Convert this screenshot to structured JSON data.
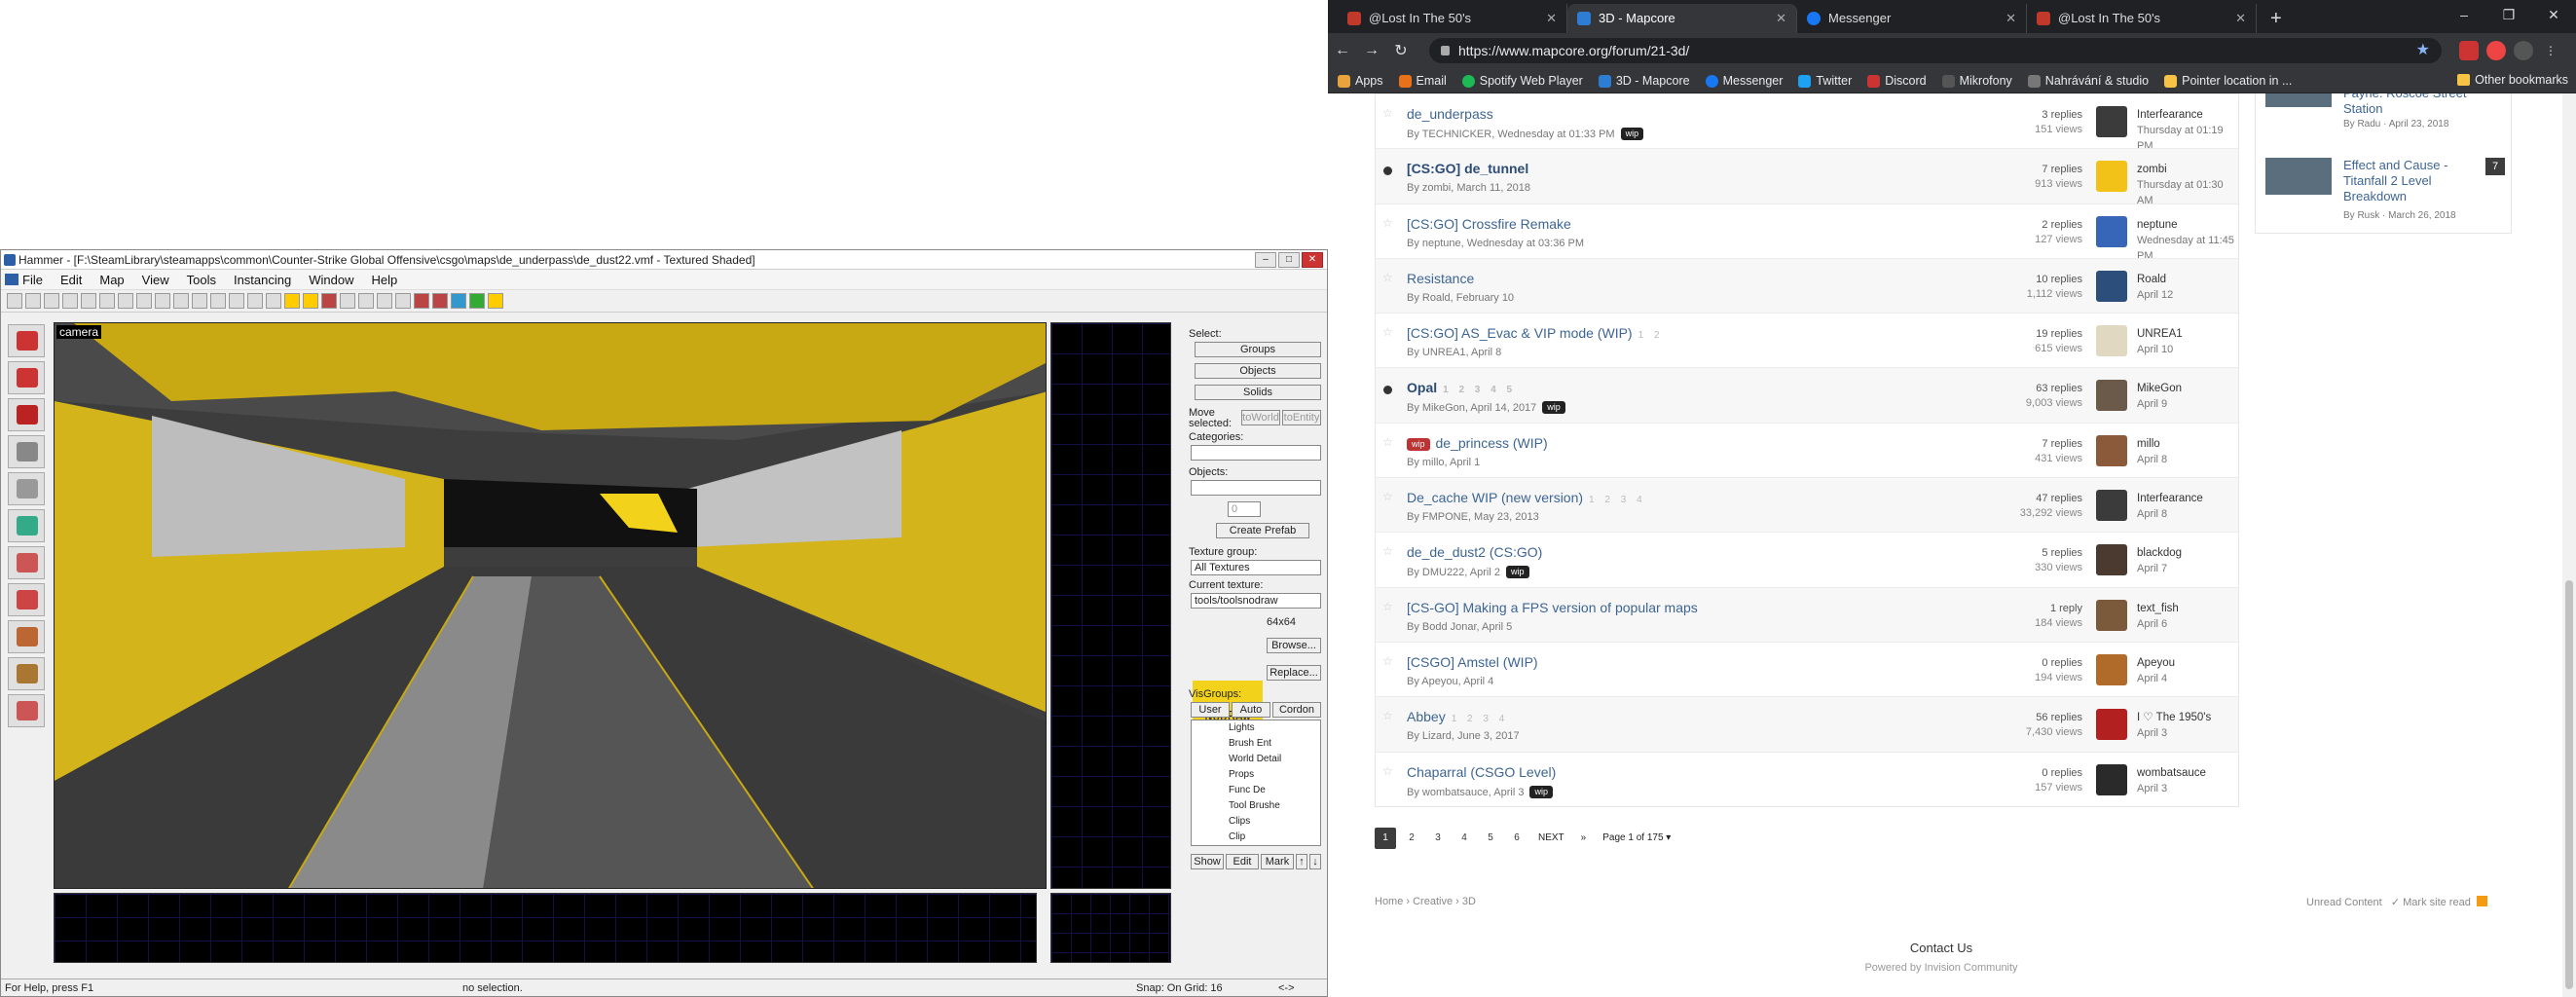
{
  "hammer": {
    "title": "Hammer - [F:\\SteamLibrary\\steamapps\\common\\Counter-Strike Global Offensive\\csgo\\maps\\de_underpass\\de_dust22.vmf - Textured Shaded]",
    "menu": [
      "File",
      "Edit",
      "Map",
      "View",
      "Tools",
      "Instancing",
      "Window",
      "Help"
    ],
    "camera_label": "camera",
    "panel": {
      "select_label": "Select:",
      "groups": "Groups",
      "objects": "Objects",
      "solids": "Solids",
      "move_selected": "Move selected:",
      "to_world": "toWorld",
      "to_entity": "toEntity",
      "categories": "Categories:",
      "objects_label": "Objects:",
      "count": "0",
      "create_prefab": "Create Prefab",
      "texture_group": "Texture group:",
      "texture_group_value": "All Textures",
      "current_texture": "Current texture:",
      "current_texture_value": "tools/toolsnodraw",
      "texture_size": "64x64",
      "texture_name": "NODRAW",
      "browse": "Browse...",
      "replace": "Replace...",
      "visgroups": "VisGroups:",
      "vis_tabs": [
        "User",
        "Auto",
        "Cordon"
      ],
      "vis_items": [
        "Lights",
        "Brush Ent",
        "World Detail",
        "Props",
        "Func De",
        "Tool Brushe",
        "Clips",
        "Clip"
      ],
      "show": "Show",
      "edit": "Edit",
      "mark": "Mark"
    },
    "status": {
      "help": "For Help, press F1",
      "selection": "no selection.",
      "snap": "Snap: On Grid: 16",
      "extra": "<->"
    }
  },
  "browser": {
    "tabs": [
      {
        "title": "@Lost In The 50's",
        "color": "#c0392b"
      },
      {
        "title": "3D - Mapcore",
        "color": "#2d7dd2"
      },
      {
        "title": "Messenger",
        "color": "#1877f2"
      },
      {
        "title": "@Lost In The 50's",
        "color": "#c0392b"
      }
    ],
    "url": "https://www.mapcore.org/forum/21-3d/",
    "bookmarks": [
      {
        "label": "Apps",
        "color": "#e8a33d"
      },
      {
        "label": "Email",
        "color": "#e8711a"
      },
      {
        "label": "Spotify Web Player",
        "color": "#1db954"
      },
      {
        "label": "3D - Mapcore",
        "color": "#2d7dd2"
      },
      {
        "label": "Messenger",
        "color": "#1877f2"
      },
      {
        "label": "Twitter",
        "color": "#1da1f2"
      },
      {
        "label": "Discord",
        "color": "#c33"
      },
      {
        "label": "Mikrofony",
        "color": "#555"
      },
      {
        "label": "Nahrávání & studio",
        "color": "#777"
      },
      {
        "label": "Pointer location in ...",
        "color": "#f6c344"
      }
    ],
    "other_bookmarks": "Other bookmarks"
  },
  "topics": [
    {
      "title": "de_underpass",
      "meta": "By TECHNICKER, Wednesday at 01:33 PM",
      "badge": "wip",
      "replies": "3 replies",
      "views": "151 views",
      "last_user": "Interfearance",
      "last_date": "Thursday at 01:19 PM",
      "unread": false,
      "bold": false,
      "pages": "",
      "av": "#3b3b3b"
    },
    {
      "title": "[CS:GO] de_tunnel",
      "meta": "By zombi, March 11, 2018",
      "badge": "",
      "replies": "7 replies",
      "views": "913 views",
      "last_user": "zombi",
      "last_date": "Thursday at 01:30 AM",
      "unread": true,
      "bold": true,
      "pages": "",
      "av": "#f2c218"
    },
    {
      "title": "[CS:GO] Crossfire Remake",
      "meta": "By neptune, Wednesday at 03:36 PM",
      "badge": "",
      "replies": "2 replies",
      "views": "127 views",
      "last_user": "neptune",
      "last_date": "Wednesday at 11:45 PM",
      "unread": false,
      "bold": false,
      "pages": "",
      "av": "#3766b8"
    },
    {
      "title": "Resistance",
      "meta": "By Roald, February 10",
      "badge": "",
      "replies": "10 replies",
      "views": "1,112 views",
      "last_user": "Roald",
      "last_date": "April 12",
      "unread": false,
      "bold": false,
      "pages": "",
      "av": "#2b4f7a"
    },
    {
      "title": "[CS:GO] AS_Evac & VIP mode (WIP)",
      "meta": "By UNREA1, April 8",
      "badge": "",
      "replies": "19 replies",
      "views": "615 views",
      "last_user": "UNREA1",
      "last_date": "April 10",
      "unread": false,
      "bold": false,
      "pages": "1 2",
      "av": "#e0d8c0"
    },
    {
      "title": "Opal",
      "meta": "By MikeGon, April 14, 2017",
      "badge": "wip",
      "replies": "63 replies",
      "views": "9,003 views",
      "last_user": "MikeGon",
      "last_date": "April 9",
      "unread": true,
      "bold": true,
      "pages": "1 2 3 4 5",
      "av": "#6b5a4a"
    },
    {
      "title": "de_princess (WIP)",
      "meta": "By millo, April 1",
      "badge": "",
      "pre_badge": "wip",
      "replies": "7 replies",
      "views": "431 views",
      "last_user": "millo",
      "last_date": "April 8",
      "unread": false,
      "bold": false,
      "pages": "",
      "av": "#8a5a3a"
    },
    {
      "title": "De_cache WIP (new version)",
      "meta": "By FMPONE, May 23, 2013",
      "badge": "",
      "replies": "47 replies",
      "views": "33,292 views",
      "last_user": "Interfearance",
      "last_date": "April 8",
      "unread": false,
      "bold": false,
      "pages": "1 2 3 4",
      "av": "#3b3b3b"
    },
    {
      "title": "de_de_dust2 (CS:GO)",
      "meta": "By DMU222, April 2",
      "badge": "wip",
      "replies": "5 replies",
      "views": "330 views",
      "last_user": "blackdog",
      "last_date": "April 7",
      "unread": false,
      "bold": false,
      "pages": "",
      "av": "#4a3a30"
    },
    {
      "title": "[CS-GO] Making a FPS version of popular maps",
      "meta": "By Bodd Jonar, April 5",
      "badge": "",
      "replies": "1 reply",
      "views": "184 views",
      "last_user": "text_fish",
      "last_date": "April 6",
      "unread": false,
      "bold": false,
      "pages": "",
      "av": "#7a5a3a"
    },
    {
      "title": "[CSGO] Amstel (WIP)",
      "meta": "By Apeyou, April 4",
      "badge": "",
      "replies": "0 replies",
      "views": "194 views",
      "last_user": "Apeyou",
      "last_date": "April 4",
      "unread": false,
      "bold": false,
      "pages": "",
      "av": "#b06a2a"
    },
    {
      "title": "Abbey",
      "meta": "By Lizard, June 3, 2017",
      "badge": "",
      "replies": "56 replies",
      "views": "7,430 views",
      "last_user": "I ♡ The 1950's",
      "last_date": "April 3",
      "unread": false,
      "bold": false,
      "pages": "1 2 3 4",
      "av": "#b32020"
    },
    {
      "title": "Chaparral (CSGO Level)",
      "meta": "By wombatsauce, April 3",
      "badge": "wip",
      "replies": "0 replies",
      "views": "157 views",
      "last_user": "wombatsauce",
      "last_date": "April 3",
      "unread": false,
      "bold": false,
      "pages": "",
      "av": "#2a2a2a"
    }
  ],
  "pagination": {
    "pages": [
      "1",
      "2",
      "3",
      "4",
      "5",
      "6"
    ],
    "next": "NEXT",
    "last": "»",
    "info": "Page 1 of 175 ▾"
  },
  "sidebar": [
    {
      "title": "Payne: Roscoe Street Station",
      "meta": "By Radu · April 23, 2018",
      "count": ""
    },
    {
      "title": "Effect and Cause - Titanfall 2 Level Breakdown",
      "meta": "By Rusk · March 26, 2018",
      "count": "7"
    }
  ],
  "footer": {
    "crumbs": "Home › Creative › 3D",
    "unread": "Unread Content",
    "mark": "Mark site read",
    "contact": "Contact Us",
    "powered": "Powered by Invision Community"
  }
}
